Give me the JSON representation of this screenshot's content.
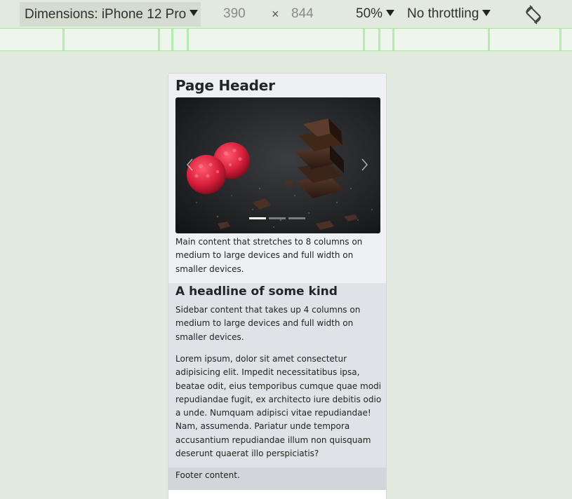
{
  "toolbar": {
    "dimensions_label": "Dimensions: iPhone 12 Pro",
    "width": "390",
    "times": "×",
    "height": "844",
    "zoom": "50%",
    "throttling": "No throttling",
    "rotate_icon": "rotate-icon"
  },
  "page": {
    "header": "Page Header",
    "carousel": {
      "prev_icon": "chevron-left-icon",
      "next_icon": "chevron-right-icon",
      "indicator_count": 3,
      "active_index": 0
    },
    "main_text": "Main content that stretches to 8 columns on medium to large devices and full width on smaller devices.",
    "sidebar_headline": "A headline of some kind",
    "sidebar_text": "Sidebar content that takes up 4 columns on medium to large devices and full width on smaller devices.",
    "lorem": "Lorem ipsum, dolor sit amet consectetur adipisicing elit. Impedit necessitatibus ipsa, beatae odit, eius temporibus cumque quae modi repudiandae fugit, ex architecto iure debitis odio a unde. Numquam adipisci vitae repudiandae! Nam, assumenda. Pariatur unde tempora accusantium repudiandae illum non quisquam deserunt quaerat illo perspiciatis?",
    "footer": "Footer content."
  },
  "colors": {
    "canvas": "#e2eadf",
    "ruler": "#eef5ec",
    "ruler_marks": "#b5ebb0",
    "main_bg": "#eef0f3",
    "sidebar_bg": "#dfe2e6",
    "footer_bg": "#d2d6db"
  }
}
